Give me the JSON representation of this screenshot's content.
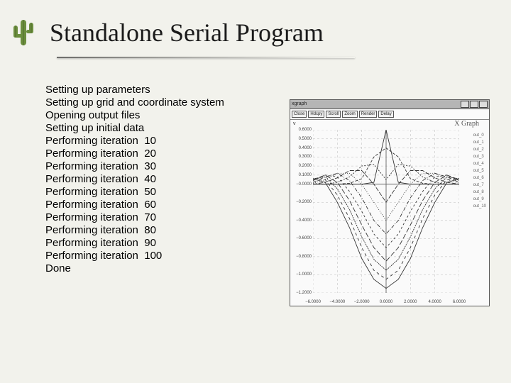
{
  "title": "Standalone Serial Program",
  "terminal_lines": [
    "Setting up parameters",
    "Setting up grid and coordinate system",
    "Opening output files",
    "Setting up initial data",
    "Performing iteration  10",
    "Performing iteration  20",
    "Performing iteration  30",
    "Performing iteration  40",
    "Performing iteration  50",
    "Performing iteration  60",
    "Performing iteration  70",
    "Performing iteration  80",
    "Performing iteration  90",
    "Performing iteration  100",
    "Done"
  ],
  "xgraph": {
    "window_title": "xgraph",
    "toolbar": [
      "Close",
      "Hdcpy",
      "Scroll",
      "Zoom",
      "Render",
      "Delay"
    ],
    "chart_label": "X Graph",
    "y_axis_var": "v",
    "y_ticks": [
      "0.6000",
      "0.5000",
      "0.4000",
      "0.3000",
      "0.2000",
      "0.1000",
      "−0.0000",
      "−0.2000",
      "−0.4000",
      "−0.6000",
      "−0.8000",
      "−1.0000",
      "−1.2000"
    ],
    "x_ticks": [
      "−6.0000",
      "−4.0000",
      "−2.0000",
      "0.0000",
      "2.0000",
      "4.0000",
      "6.0000"
    ],
    "legend_items": [
      "out_0",
      "out_1",
      "out_2",
      "out_3",
      "out_4",
      "out_5",
      "out_6",
      "out_7",
      "out_8",
      "out_9",
      "out_10"
    ]
  },
  "chart_data": {
    "type": "line",
    "title": "X Graph",
    "xlabel": "",
    "ylabel": "v",
    "xlim": [
      -6,
      6
    ],
    "ylim": [
      -1.2,
      0.6
    ],
    "x": [
      -6,
      -5,
      -4,
      -3,
      -2,
      -1,
      0,
      1,
      2,
      3,
      4,
      5,
      6
    ],
    "series": [
      {
        "name": "out_0",
        "values": [
          0.0,
          0.0,
          0.0,
          0.0,
          0.0,
          0.02,
          0.6,
          0.02,
          0.0,
          0.0,
          0.0,
          0.0,
          0.0
        ]
      },
      {
        "name": "out_1",
        "values": [
          0.0,
          0.0,
          0.0,
          0.01,
          0.06,
          0.3,
          0.4,
          0.3,
          0.06,
          0.01,
          0.0,
          0.0,
          0.0
        ]
      },
      {
        "name": "out_2",
        "values": [
          0.0,
          0.0,
          0.02,
          0.08,
          0.2,
          0.22,
          0.05,
          0.22,
          0.2,
          0.08,
          0.02,
          0.0,
          0.0
        ]
      },
      {
        "name": "out_3",
        "values": [
          0.0,
          0.02,
          0.07,
          0.15,
          0.15,
          0.0,
          -0.2,
          0.0,
          0.15,
          0.15,
          0.07,
          0.02,
          0.0
        ]
      },
      {
        "name": "out_4",
        "values": [
          0.01,
          0.05,
          0.12,
          0.12,
          0.0,
          -0.2,
          -0.4,
          -0.2,
          0.0,
          0.12,
          0.12,
          0.05,
          0.01
        ]
      },
      {
        "name": "out_5",
        "values": [
          0.02,
          0.08,
          0.12,
          0.04,
          -0.15,
          -0.4,
          -0.55,
          -0.4,
          -0.15,
          0.04,
          0.12,
          0.08,
          0.02
        ]
      },
      {
        "name": "out_6",
        "values": [
          0.04,
          0.1,
          0.08,
          -0.08,
          -0.3,
          -0.55,
          -0.7,
          -0.55,
          -0.3,
          -0.08,
          0.08,
          0.1,
          0.04
        ]
      },
      {
        "name": "out_7",
        "values": [
          0.05,
          0.1,
          0.02,
          -0.18,
          -0.45,
          -0.7,
          -0.85,
          -0.7,
          -0.45,
          -0.18,
          0.02,
          0.1,
          0.05
        ]
      },
      {
        "name": "out_8",
        "values": [
          0.06,
          0.08,
          -0.05,
          -0.28,
          -0.58,
          -0.83,
          -0.95,
          -0.83,
          -0.58,
          -0.28,
          -0.05,
          0.08,
          0.06
        ]
      },
      {
        "name": "out_9",
        "values": [
          0.06,
          0.05,
          -0.12,
          -0.38,
          -0.7,
          -0.95,
          -1.05,
          -0.95,
          -0.7,
          -0.38,
          -0.12,
          0.05,
          0.06
        ]
      },
      {
        "name": "out_10",
        "values": [
          0.06,
          0.02,
          -0.2,
          -0.48,
          -0.82,
          -1.05,
          -1.15,
          -1.05,
          -0.82,
          -0.48,
          -0.2,
          0.02,
          0.06
        ]
      }
    ]
  }
}
